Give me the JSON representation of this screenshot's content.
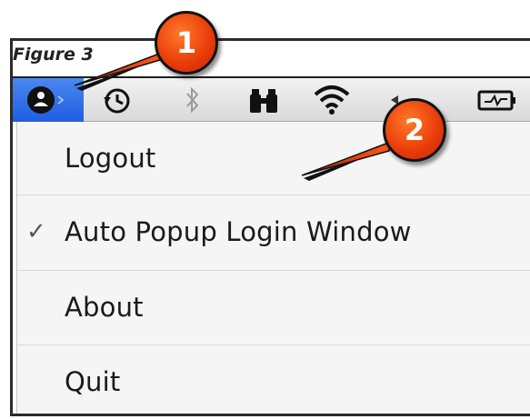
{
  "caption": "Figure 3",
  "badges": {
    "one": "1",
    "two": "2"
  },
  "menubar": {
    "icons": [
      "user-menu-icon",
      "time-machine-icon",
      "bluetooth-icon",
      "binoculars-icon",
      "wifi-icon",
      "volume-icon",
      "battery-charging-icon"
    ]
  },
  "menu": {
    "items": [
      {
        "label": "Logout",
        "checked": false
      },
      {
        "label": "Auto Popup Login Window",
        "checked": true
      },
      {
        "label": "About",
        "checked": false
      },
      {
        "label": "Quit",
        "checked": false
      }
    ],
    "checkmark": "✓"
  },
  "colors": {
    "badge": "#e83a08",
    "highlight": "#1f5ee0"
  }
}
